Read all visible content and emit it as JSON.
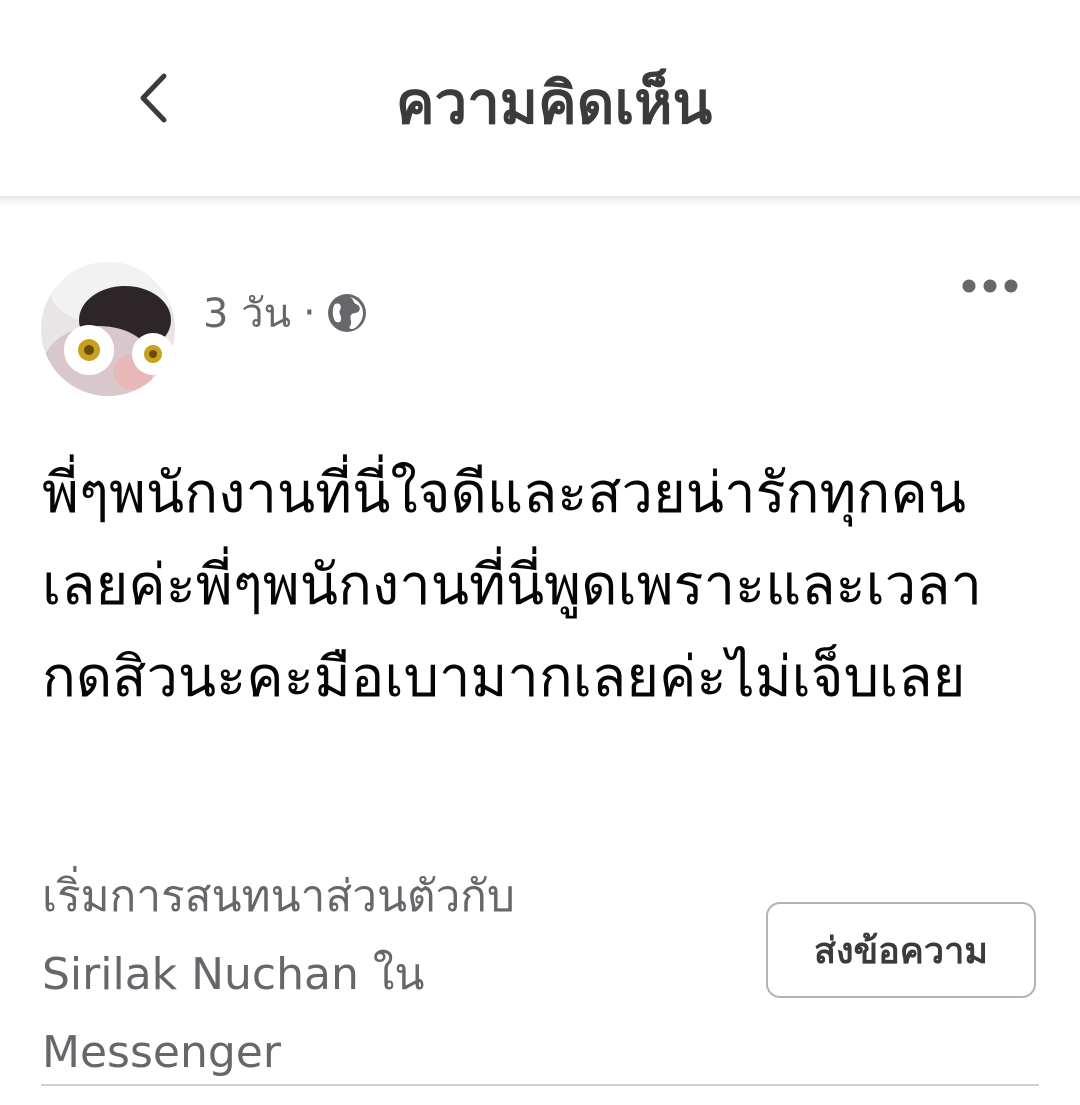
{
  "header": {
    "title": "ความคิดเห็น",
    "back_icon": "chevron-left-icon"
  },
  "comment": {
    "time": "3 วัน",
    "separator": "·",
    "privacy_icon": "globe-icon",
    "more_icon": "more-horizontal-icon",
    "text": "พี่ๆพนักงานที่นี่ใจดีและสวยน่ารักทุกคนเลยค่ะพี่ๆพนักงานที่นี่พูดเพราะและเวลากดสิวนะคะมือเบามากเลยค่ะไม่เจ็บเลย"
  },
  "messenger": {
    "prompt_line1": "เริ่มการสนทนาส่วนตัวกับ",
    "prompt_line2": "Sirilak Nuchan ใน",
    "prompt_line3": "Messenger",
    "send_label": "ส่งข้อความ"
  },
  "colors": {
    "text_primary": "#050505",
    "text_secondary": "#65676b",
    "title": "#3b3b3c",
    "border": "#b0b3b8",
    "divider": "#ced0d4"
  }
}
